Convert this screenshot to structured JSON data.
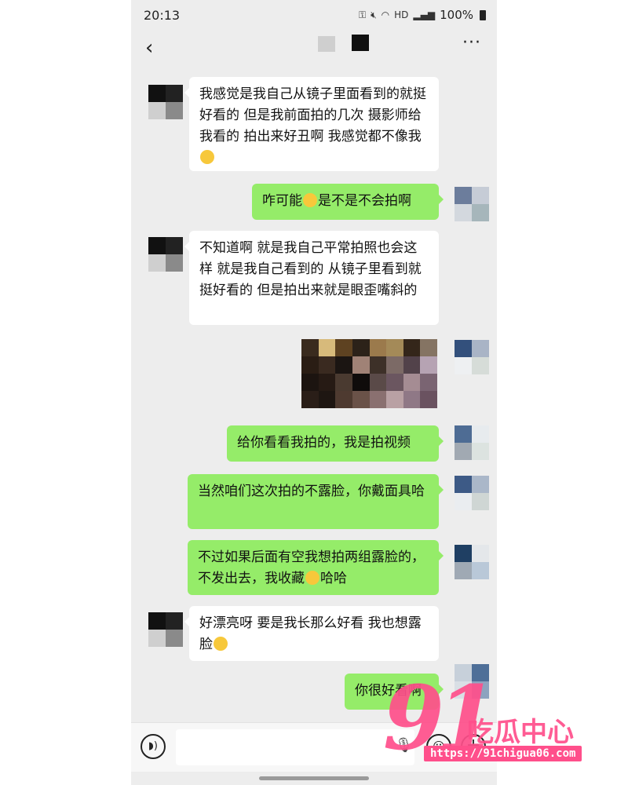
{
  "status": {
    "time": "20:13",
    "battery": "100%",
    "network": "HD"
  },
  "nav": {
    "back_icon": "chevron-left-icon",
    "more": "···"
  },
  "messages": [
    {
      "side": "in",
      "text": "我感觉是我自己从镜子里面看到的就挺好看的 但是我前面拍的几次 摄影师给我看的 拍出来好丑啊 我感觉都不像我",
      "emoji": "crying-face"
    },
    {
      "side": "out",
      "text_before": "咋可能",
      "emoji": "laughing-face",
      "text_after": "是不是不会拍啊"
    },
    {
      "side": "in",
      "text": "不知道啊 就是我自己平常拍照也会这样 就是我自己看到的 从镜子里看到就挺好看的 但是拍出来就是眼歪嘴斜的"
    },
    {
      "side": "out",
      "type": "image",
      "description": "pixelated photo"
    },
    {
      "side": "out",
      "text": "给你看看我拍的，我是拍视频"
    },
    {
      "side": "out",
      "text": "当然咱们这次拍的不露脸，你戴面具哈"
    },
    {
      "side": "out",
      "text_before": "不过如果后面有空我想拍两组露脸的，不发出去，我收藏",
      "emoji": "laughing-face",
      "text_after": "哈哈"
    },
    {
      "side": "in",
      "text": "好漂亮呀 要是我长那么好看 我也想露脸",
      "emoji": "grinning-face"
    },
    {
      "side": "out",
      "text": "你很好看啊"
    }
  ],
  "watermark": {
    "number": "91",
    "name": "吃瓜中心",
    "url": "https://91chigua06.com"
  },
  "colors": {
    "bg": "#ededed",
    "out_bubble": "#95ec69",
    "in_bubble": "#ffffff",
    "watermark": "#ff4f8b"
  }
}
